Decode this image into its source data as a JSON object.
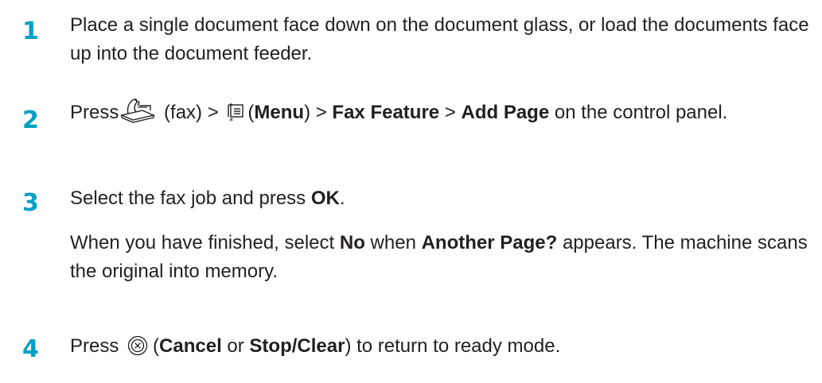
{
  "steps": [
    {
      "number": "1",
      "line1": "Place a single document face down on the document glass, or load the documents face up into the document feeder."
    },
    {
      "number": "2",
      "press": "Press",
      "fax_label": "(fax) >",
      "menu_open": "(",
      "menu_label": "Menu",
      "menu_close": ") >",
      "fax_feature": "Fax Feature",
      "sep": ">",
      "add_page": "Add Page",
      "tail": "on the control panel.",
      "icons": [
        "fax-icon",
        "menu-icon"
      ]
    },
    {
      "number": "3",
      "pre": "Select the fax job and press",
      "ok": "OK",
      "dot": ".",
      "p2_pre": "When you have finished, select",
      "no": "No",
      "when": "when",
      "another": "Another Page?",
      "p2_tail": "appears. The machine scans the original into memory."
    },
    {
      "number": "4",
      "press": "Press",
      "open": "(",
      "cancel": "Cancel",
      "or": "or",
      "stop": "Stop/Clear",
      "tail": ") to return to ready mode.",
      "icons": [
        "cancel-icon"
      ]
    }
  ],
  "colors": {
    "step_number": "#00a0c6",
    "text": "#231f20"
  }
}
